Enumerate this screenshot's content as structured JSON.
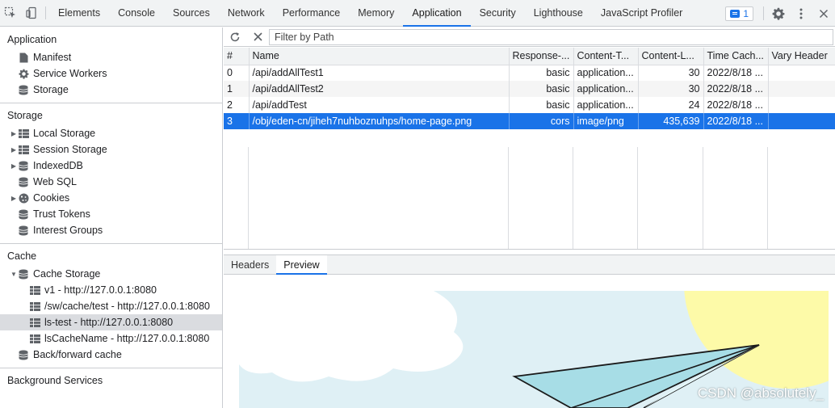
{
  "topbar": {
    "tabs": [
      "Elements",
      "Console",
      "Sources",
      "Network",
      "Performance",
      "Memory",
      "Application",
      "Security",
      "Lighthouse",
      "JavaScript Profiler"
    ],
    "active_tab": "Application",
    "issues_count": "1"
  },
  "sidebar": {
    "application": {
      "title": "Application",
      "items": [
        "Manifest",
        "Service Workers",
        "Storage"
      ]
    },
    "storage": {
      "title": "Storage",
      "items": [
        "Local Storage",
        "Session Storage",
        "IndexedDB",
        "Web SQL",
        "Cookies",
        "Trust Tokens",
        "Interest Groups"
      ]
    },
    "cache": {
      "title": "Cache",
      "cache_storage": "Cache Storage",
      "caches": [
        "v1 - http://127.0.0.1:8080",
        "/sw/cache/test - http://127.0.0.1:8080",
        "ls-test - http://127.0.0.1:8080",
        "lsCacheName - http://127.0.0.1:8080"
      ],
      "selected_cache": "ls-test - http://127.0.0.1:8080",
      "bfcache": "Back/forward cache"
    },
    "background": {
      "title": "Background Services"
    }
  },
  "toolbar": {
    "filter_placeholder": "Filter by Path"
  },
  "table": {
    "columns": [
      "#",
      "Name",
      "Response-...",
      "Content-T...",
      "Content-L...",
      "Time Cach...",
      "Vary Header"
    ],
    "rows": [
      {
        "idx": "0",
        "name": "/api/addAllTest1",
        "response": "basic",
        "ctype": "application...",
        "clen": "30",
        "time": "2022/8/18 ...",
        "vary": ""
      },
      {
        "idx": "1",
        "name": "/api/addAllTest2",
        "response": "basic",
        "ctype": "application...",
        "clen": "30",
        "time": "2022/8/18 ...",
        "vary": ""
      },
      {
        "idx": "2",
        "name": "/api/addTest",
        "response": "basic",
        "ctype": "application...",
        "clen": "24",
        "time": "2022/8/18 ...",
        "vary": ""
      },
      {
        "idx": "3",
        "name": "/obj/eden-cn/jiheh7nuhboznuhps/home-page.png",
        "response": "cors",
        "ctype": "image/png",
        "clen": "435,639",
        "time": "2022/8/18 ...",
        "vary": ""
      }
    ],
    "selected_row": 3
  },
  "detail_tabs": [
    "Headers",
    "Preview"
  ],
  "active_detail_tab": "Preview",
  "watermark": "CSDN @absolutely_",
  "colors": {
    "accent": "#1a73e8",
    "selection": "#1a73e8",
    "sky": "#dff0f5",
    "sun": "#fdfaa8",
    "plane": "#a7dde6"
  }
}
